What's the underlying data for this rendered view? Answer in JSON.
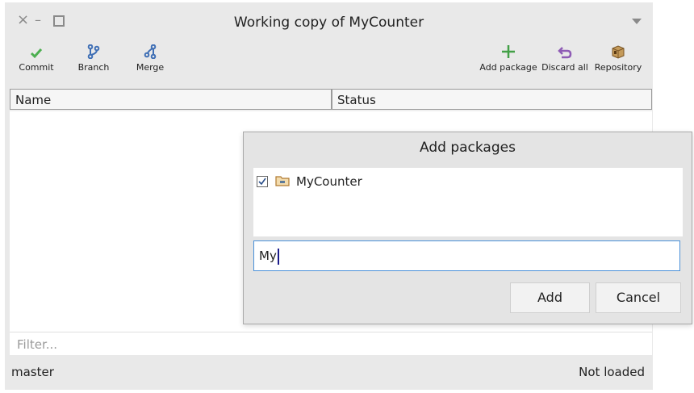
{
  "window": {
    "title": "Working copy of MyCounter",
    "controls": [
      "close-icon",
      "minimize-icon",
      "maximize-icon",
      "window-menu-icon"
    ]
  },
  "toolbar": {
    "commit": {
      "label": "Commit",
      "icon": "checkmark-icon",
      "color": "#4caf50"
    },
    "branch": {
      "label": "Branch",
      "icon": "branch-icon",
      "color": "#3f6fb5"
    },
    "merge": {
      "label": "Merge",
      "icon": "merge-icon",
      "color": "#3f6fb5"
    },
    "add_package": {
      "label": "Add package",
      "icon": "plus-icon",
      "color": "#43a047"
    },
    "discard_all": {
      "label": "Discard all",
      "icon": "undo-icon",
      "color": "#8e5bb5"
    },
    "repository": {
      "label": "Repository",
      "icon": "repository-box-icon",
      "color": "#a87a3a"
    }
  },
  "table": {
    "columns": [
      "Name",
      "Status"
    ]
  },
  "filter": {
    "placeholder": "Filter..."
  },
  "status": {
    "branch": "master",
    "load_state": "Not loaded"
  },
  "dialog": {
    "title": "Add packages",
    "packages": [
      {
        "name": "MyCounter",
        "checked": true
      }
    ],
    "input_value": "My",
    "add_label": "Add",
    "cancel_label": "Cancel"
  }
}
